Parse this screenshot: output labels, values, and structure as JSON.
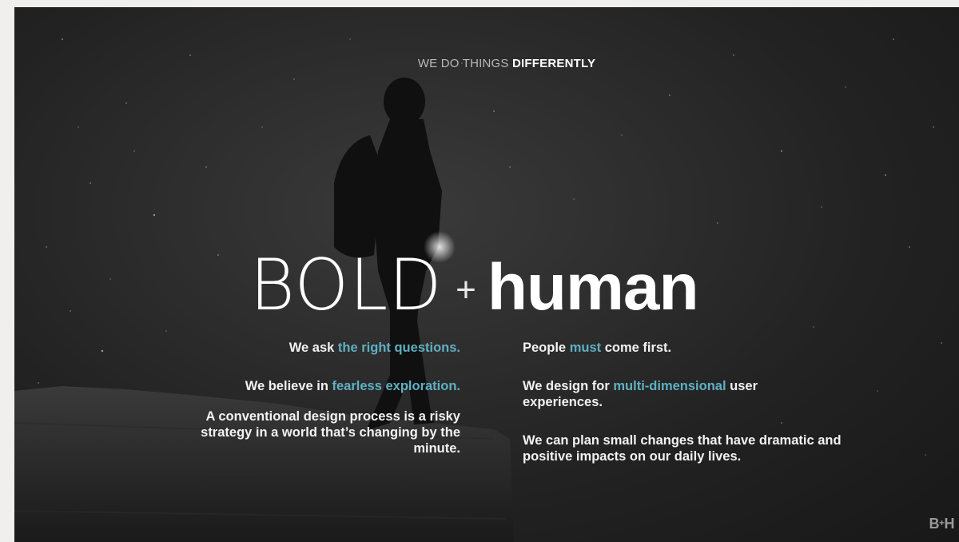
{
  "kicker": {
    "light": "WE DO THINGS",
    "bold": "DIFFERENTLY"
  },
  "headline": {
    "bold": "BOLD",
    "plus": "+",
    "human": "human"
  },
  "left_column": [
    {
      "pre": "We ask ",
      "accent": "the right questions.",
      "post": ""
    },
    {
      "pre": "We believe in ",
      "accent": "fearless exploration.",
      "post": ""
    },
    {
      "pre": "A conventional design process is a risky strategy in a world that’s changing by the minute.",
      "accent": "",
      "post": ""
    }
  ],
  "right_column": [
    {
      "pre": "People ",
      "accent": "must",
      "post": " come first."
    },
    {
      "pre": "We design for ",
      "accent": "multi-dimensional",
      "post": " user experiences."
    },
    {
      "pre": "We can plan small changes that have dramatic and positive impacts on our daily lives.",
      "accent": "",
      "post": ""
    }
  ],
  "logo": {
    "left": "B",
    "plus": "+",
    "right": "H"
  },
  "colors": {
    "accent": "#5fb0c2",
    "text": "#f2f2f2",
    "background": "#222222"
  }
}
